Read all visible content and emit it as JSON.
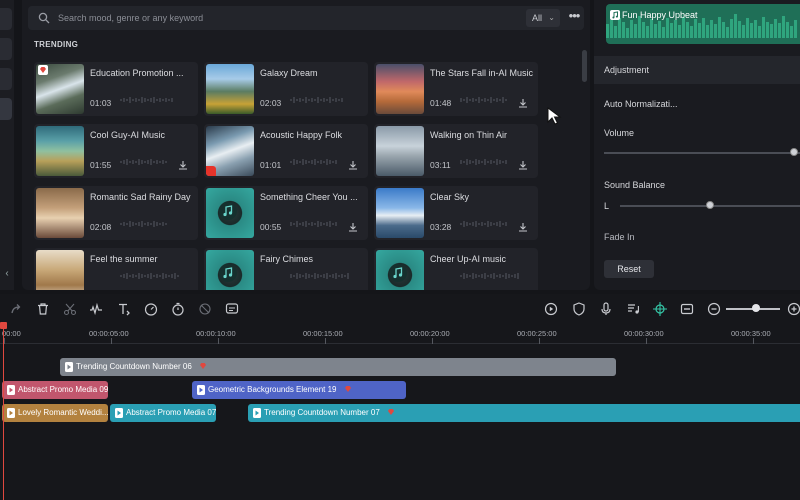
{
  "library": {
    "search_placeholder": "Search mood, genre or any keyword",
    "filter_value": "All",
    "section_label": "TRENDING",
    "items": [
      {
        "title": "Education Promotion ...",
        "duration": "01:03"
      },
      {
        "title": "Galaxy Dream",
        "duration": "02:03"
      },
      {
        "title": "The Stars Fall in-AI Music",
        "duration": "01:48"
      },
      {
        "title": "Cool Guy-AI Music",
        "duration": "01:55"
      },
      {
        "title": "Acoustic Happy Folk",
        "duration": "01:01"
      },
      {
        "title": "Walking on Thin Air",
        "duration": "03:11"
      },
      {
        "title": "Romantic Sad Rainy Day",
        "duration": "02:08"
      },
      {
        "title": "Something Cheer You ...",
        "duration": "00:55"
      },
      {
        "title": "Clear Sky",
        "duration": "03:28"
      },
      {
        "title": "Feel the summer",
        "duration": ""
      },
      {
        "title": "Fairy Chimes",
        "duration": ""
      },
      {
        "title": "Cheer Up-AI music",
        "duration": ""
      }
    ]
  },
  "properties": {
    "preview_title": "Fun Happy Upbeat",
    "adjustment_label": "Adjustment",
    "auto_normalization_label": "Auto Normalizati...",
    "volume_label": "Volume",
    "volume_level": 0.97,
    "sound_balance_label": "Sound Balance",
    "balance_left_label": "L",
    "balance_level": 0.5,
    "fade_in_label": "Fade In",
    "reset_label": "Reset"
  },
  "timeline": {
    "ruler": [
      "00:00",
      "00:00:05:00",
      "00:00:10:00",
      "00:00:15:00",
      "00:00:20:00",
      "00:00:25:00",
      "00:00:30:00",
      "00:00:35:00"
    ],
    "zoom_level": 0.55,
    "clips": [
      {
        "label": "Trending Countdown Number 06",
        "color": "#7e848d",
        "gem": true
      },
      {
        "label": "Abstract Promo Media 09",
        "color": "#c1566d",
        "gem": false
      },
      {
        "label": "Geometric Backgrounds Element 19",
        "color": "#4f64c7",
        "gem": true
      },
      {
        "label": "Lovely Romantic Weddi...",
        "color": "#b3823f",
        "gem": false
      },
      {
        "label": "Abstract Promo Media 07",
        "color": "#2a9fb4",
        "gem": false
      },
      {
        "label": "Trending Countdown Number 07",
        "color": "#2a9fb4",
        "gem": true
      }
    ]
  },
  "colors": {
    "accent_red": "#e0483f",
    "preview_green": "#1f6f57"
  }
}
